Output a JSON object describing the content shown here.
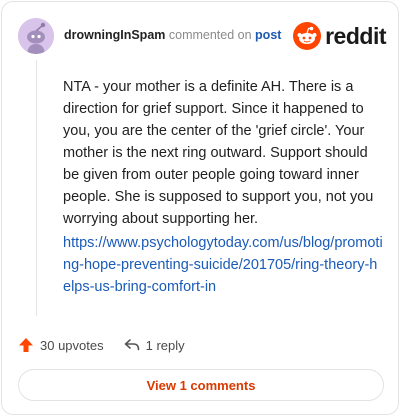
{
  "comment": {
    "author": "drowningInSpam",
    "verb": "commented on",
    "target": "post",
    "body": "NTA - your mother is a definite AH. There is a direction for grief support. Since it happened to you, you are the center of the 'grief circle'. Your mother is the next ring outward. Support should be given from outer people going toward inner people. She is supposed to support you, not you worrying about supporting her.",
    "link": "https://www.psychologytoday.com/us/blog/promoting-hope-preventing-suicide/201705/ring-theory-helps-us-bring-comfort-in"
  },
  "brand": {
    "name": "reddit",
    "color": "#ff4500"
  },
  "actions": {
    "upvotes": "30 upvotes",
    "replies": "1 reply"
  },
  "view_button": {
    "label": "View 1 comments",
    "color": "#d93a00"
  },
  "icons": {
    "avatar": "snoo-avatar-icon",
    "logo": "reddit-snoo-icon",
    "upvote": "upvote-arrow-icon",
    "reply": "reply-arrow-icon"
  }
}
